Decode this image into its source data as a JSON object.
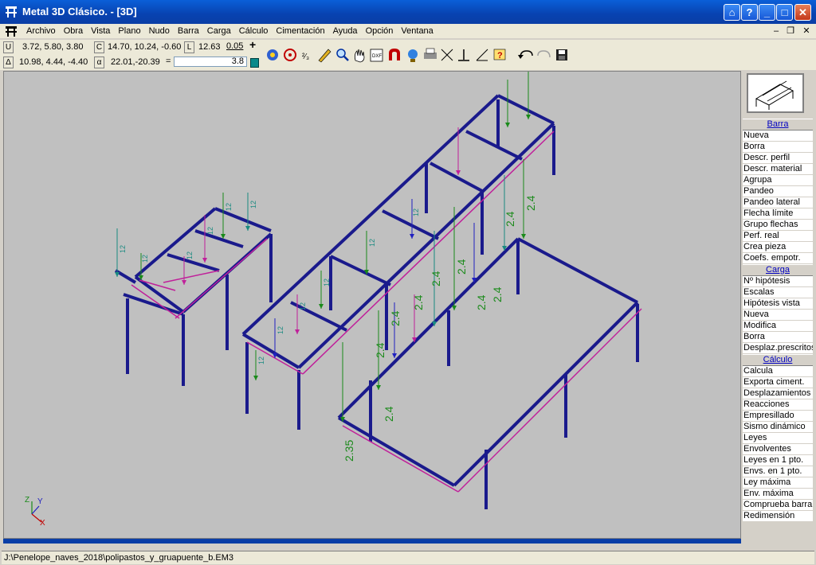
{
  "window": {
    "title": "Metal 3D Clásico. - [3D]"
  },
  "menu": [
    "Archivo",
    "Obra",
    "Vista",
    "Plano",
    "Nudo",
    "Barra",
    "Carga",
    "Cálculo",
    "Cimentación",
    "Ayuda",
    "Opción",
    "Ventana"
  ],
  "coords": {
    "u_label": "U",
    "u_value": "3.72,  5.80,  3.80",
    "c_label": "C",
    "c_value": "14.70, 10.24, -0.60",
    "l_label": "L",
    "l_value": "12.63",
    "step_value": "0.05",
    "d_label": "Δ",
    "d_value": "10.98,  4.44, -4.40",
    "a_label": "α",
    "a_value": "22.01,-20.39",
    "scale_label": "=",
    "scale_value": "3.8"
  },
  "sidebar": {
    "sections": [
      {
        "header": "Barra",
        "items": [
          "Nueva",
          "Borra",
          "Descr. perfil",
          "Descr. material",
          "Agrupa",
          "Pandeo",
          "Pandeo lateral",
          "Flecha límite",
          "Grupo flechas",
          "Perf. real",
          "Crea pieza",
          "Coefs. empotr."
        ]
      },
      {
        "header": "Carga",
        "items": [
          "Nº hipótesis",
          "Escalas",
          "Hipótesis vista",
          "Nueva",
          "Modifica",
          "Borra",
          "Desplaz.prescritos"
        ]
      },
      {
        "header": "Cálculo",
        "items": [
          "Calcula",
          "Exporta ciment.",
          "Desplazamientos",
          "Reacciones",
          "Empresillado",
          "Sismo dinámico",
          "Leyes",
          "Envolventes",
          "Leyes en 1 pto.",
          "Envs. en 1 pto.",
          "Ley máxima",
          "Env. máxima",
          "Comprueba barra",
          "Redimensión"
        ]
      }
    ]
  },
  "model": {
    "load_labels": [
      "12",
      "12",
      "12",
      "12",
      "12",
      "12",
      "12",
      "12",
      "12",
      "12",
      "12",
      "12",
      "2.4",
      "2.4",
      "2.4",
      "2.4",
      "2.4",
      "2.4",
      "2.4",
      "2.4",
      "2.4",
      "2.4",
      "2.35"
    ],
    "axes": {
      "x": "X",
      "y": "Y",
      "z": "Z"
    }
  },
  "status": {
    "path": "J:\\Penelope_naves_2018\\polipastos_y_gruapuente_b.EM3"
  },
  "colors": {
    "titlebar": "#0842b0",
    "frame": "#1a1a8c",
    "beam_pink": "#c0209a",
    "load_green": "#1a8a1a",
    "load_teal": "#1a8a80",
    "load_blue": "#2020c0"
  }
}
